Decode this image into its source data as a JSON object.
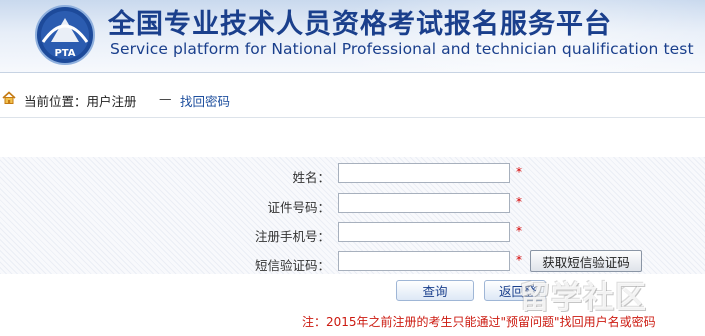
{
  "header": {
    "title_cn": "全国专业技术人员资格考试报名服务平台",
    "title_en": "Service platform for National Professional and technician  qualification test",
    "logo_text": "PTA"
  },
  "breadcrumb": {
    "current_label": "当前位置：用户注册",
    "separator": "—",
    "page": "找回密码"
  },
  "form": {
    "fields": [
      {
        "label": "姓名：",
        "value": "",
        "required_mark": "*"
      },
      {
        "label": "证件号码：",
        "value": "",
        "required_mark": "*"
      },
      {
        "label": "注册手机号：",
        "value": "",
        "required_mark": "*"
      },
      {
        "label": "短信验证码：",
        "value": "",
        "required_mark": "*"
      }
    ],
    "sms_button": "获取短信验证码",
    "query_button": "查询",
    "back_button": "返回登录"
  },
  "note": "注：2015年之前注册的考生只能通过\"预留问题\"找回用户名或密码",
  "watermark": "留学社区",
  "colors": {
    "brand": "#1a3f8c",
    "link": "#1e4f9e",
    "required": "#d40000",
    "note": "#cc1a10"
  }
}
